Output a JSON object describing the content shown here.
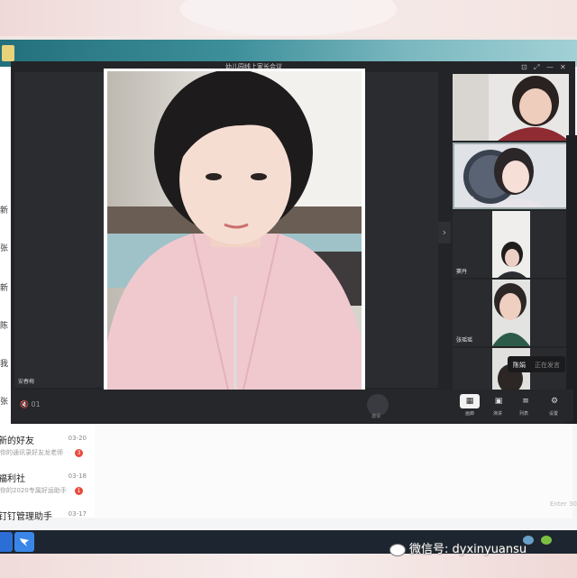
{
  "meeting": {
    "window_title": "幼儿园线上家长会议",
    "spotlight_participant": "",
    "main_participant": "安春梅",
    "participants": [
      {
        "name": ""
      },
      {
        "name": "张楠楠"
      },
      {
        "name": "窦丹"
      },
      {
        "name": "张瑶瑶"
      },
      {
        "name": ""
      }
    ],
    "speaking": {
      "name": "陈娟",
      "status": "正在发言"
    },
    "mute_label": "01",
    "round_button_label": "邀请",
    "controls": [
      {
        "label": "画廊",
        "icon": "gallery-icon"
      },
      {
        "label": "演讲",
        "icon": "speaker-view-icon"
      },
      {
        "label": "列表",
        "icon": "list-icon"
      },
      {
        "label": "设置",
        "icon": "gear-icon"
      }
    ]
  },
  "chat_list": [
    {
      "name": "新的好友",
      "preview": "你的通讯录好友龙老师",
      "date": "03-20",
      "badge": "3"
    },
    {
      "name": "福利社",
      "preview": "你的2020专属好运助手",
      "date": "03-18",
      "badge": "1"
    },
    {
      "name": "钉钉管理助手",
      "preview": "",
      "date": "03-17",
      "badge": ""
    }
  ],
  "left_peek": [
    "新",
    "张",
    "新",
    "陈",
    "我",
    "张"
  ],
  "input_hint": "Enter 30",
  "watermark": "微信号: dyxinyuansu",
  "colors": {
    "meeting_bg": "#232427",
    "accent": "#3d8f9a",
    "badge": "#e84a3b"
  }
}
